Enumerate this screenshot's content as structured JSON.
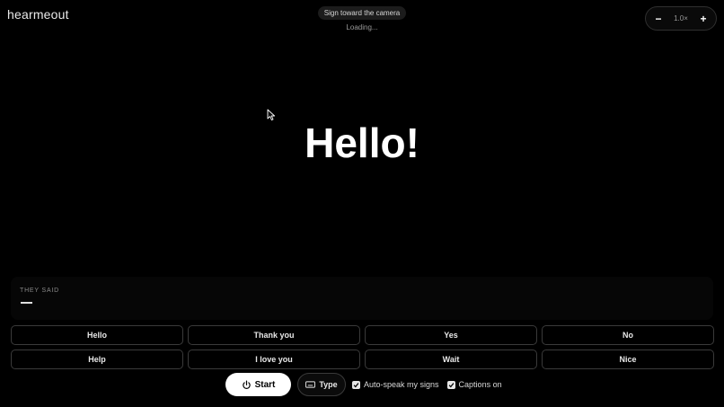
{
  "app": {
    "brand": "hearmeout",
    "prompt": "Sign toward the camera",
    "status": "Loading...",
    "zoom": {
      "minus_label": "−",
      "level": "1.0×",
      "plus_label": "+"
    }
  },
  "caption": {
    "text": "Hello!"
  },
  "they_said": {
    "label": "THEY SAID"
  },
  "phrases": [
    {
      "label": "Hello"
    },
    {
      "label": "Thank you"
    },
    {
      "label": "Yes"
    },
    {
      "label": "No"
    },
    {
      "label": "Help"
    },
    {
      "label": "I love you"
    },
    {
      "label": "Wait"
    },
    {
      "label": "Nice"
    }
  ],
  "controls": {
    "start_label": "Start",
    "type_label": "Type",
    "auto_speak": {
      "label": "Auto-speak my signs",
      "checked": true
    },
    "captions": {
      "label": "Captions on",
      "checked": true
    }
  },
  "icons": {
    "start": "power-icon",
    "type": "keyboard-icon",
    "checkbox": "checkmark-icon",
    "cursor": "mouse-pointer-icon"
  },
  "colors": {
    "background": "#000000",
    "text": "#ffffff",
    "border": "#3a3a3a",
    "start_button": "#ffffff"
  }
}
